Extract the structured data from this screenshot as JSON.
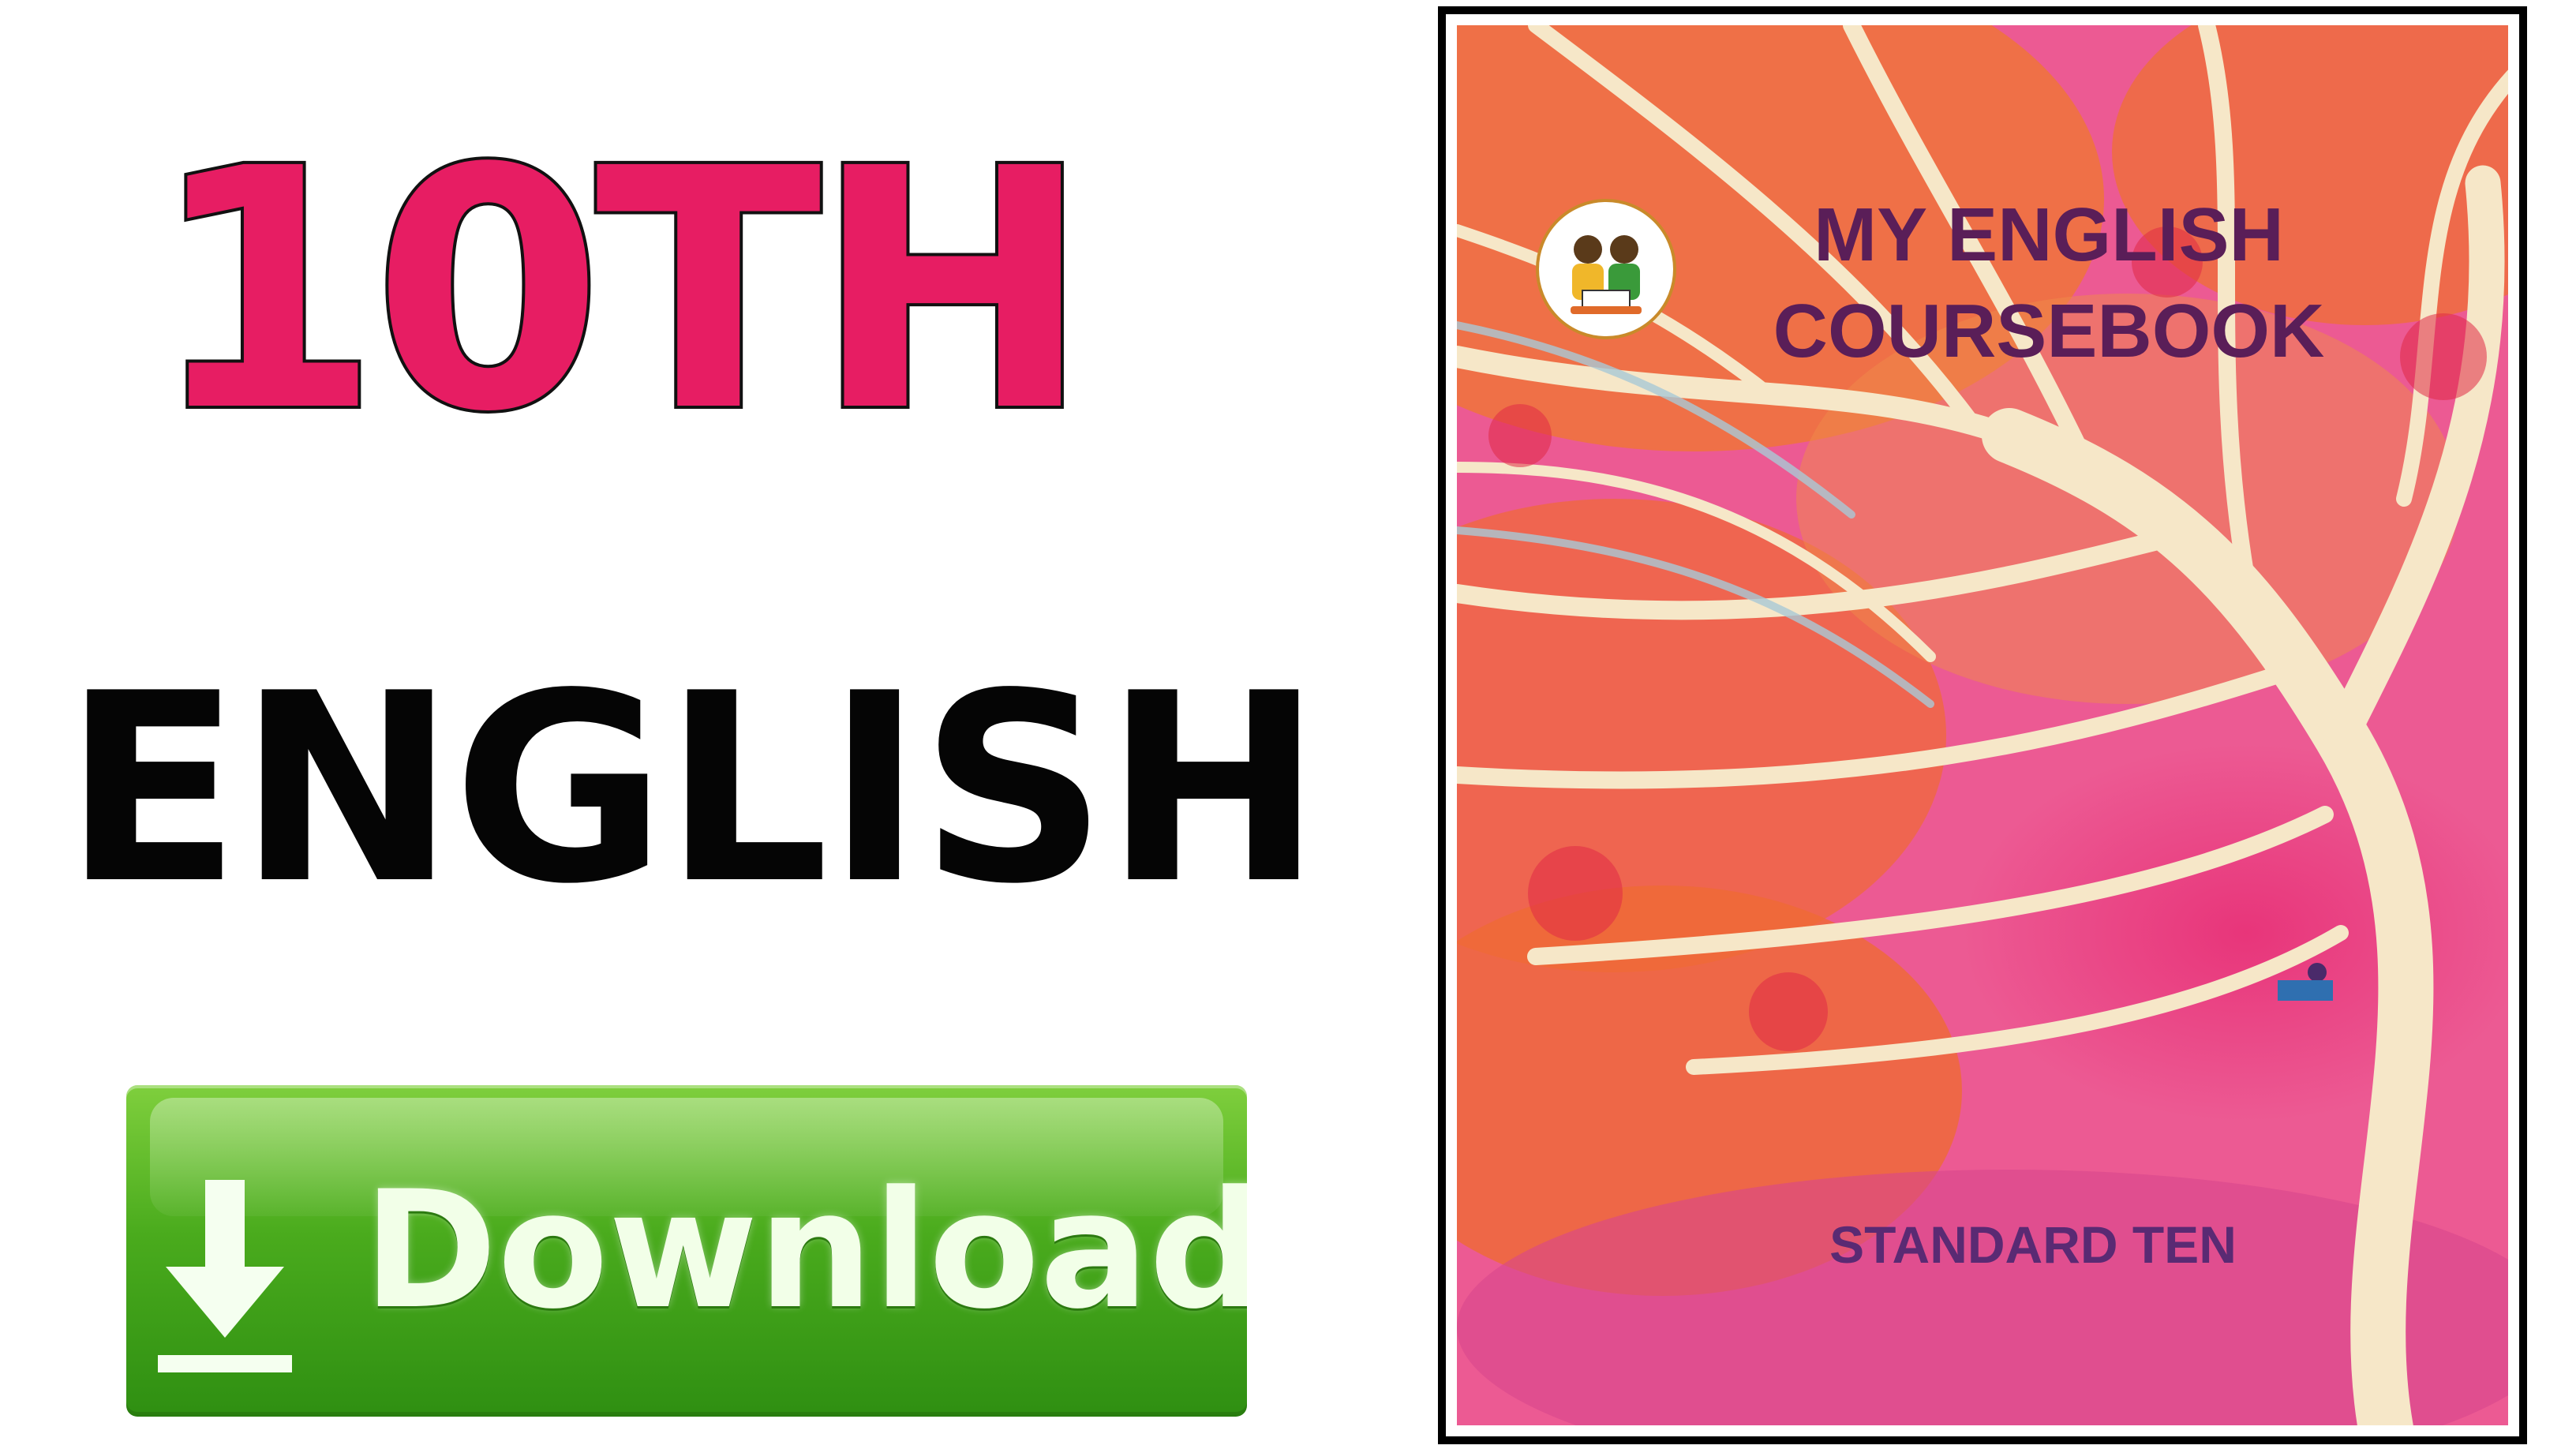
{
  "headline": {
    "grade": "10TH",
    "subject": "ENGLISH"
  },
  "download_button": {
    "label": "Download",
    "icon": "download-arrow-icon",
    "color": "#4aab1d"
  },
  "book_cover": {
    "title": "MY ENGLISH COURSEBOOK",
    "standard": "STANDARD TEN"
  },
  "colors": {
    "accent_pink": "#e71d63",
    "text_black": "#050505",
    "cover_title": "#5a1e58"
  }
}
